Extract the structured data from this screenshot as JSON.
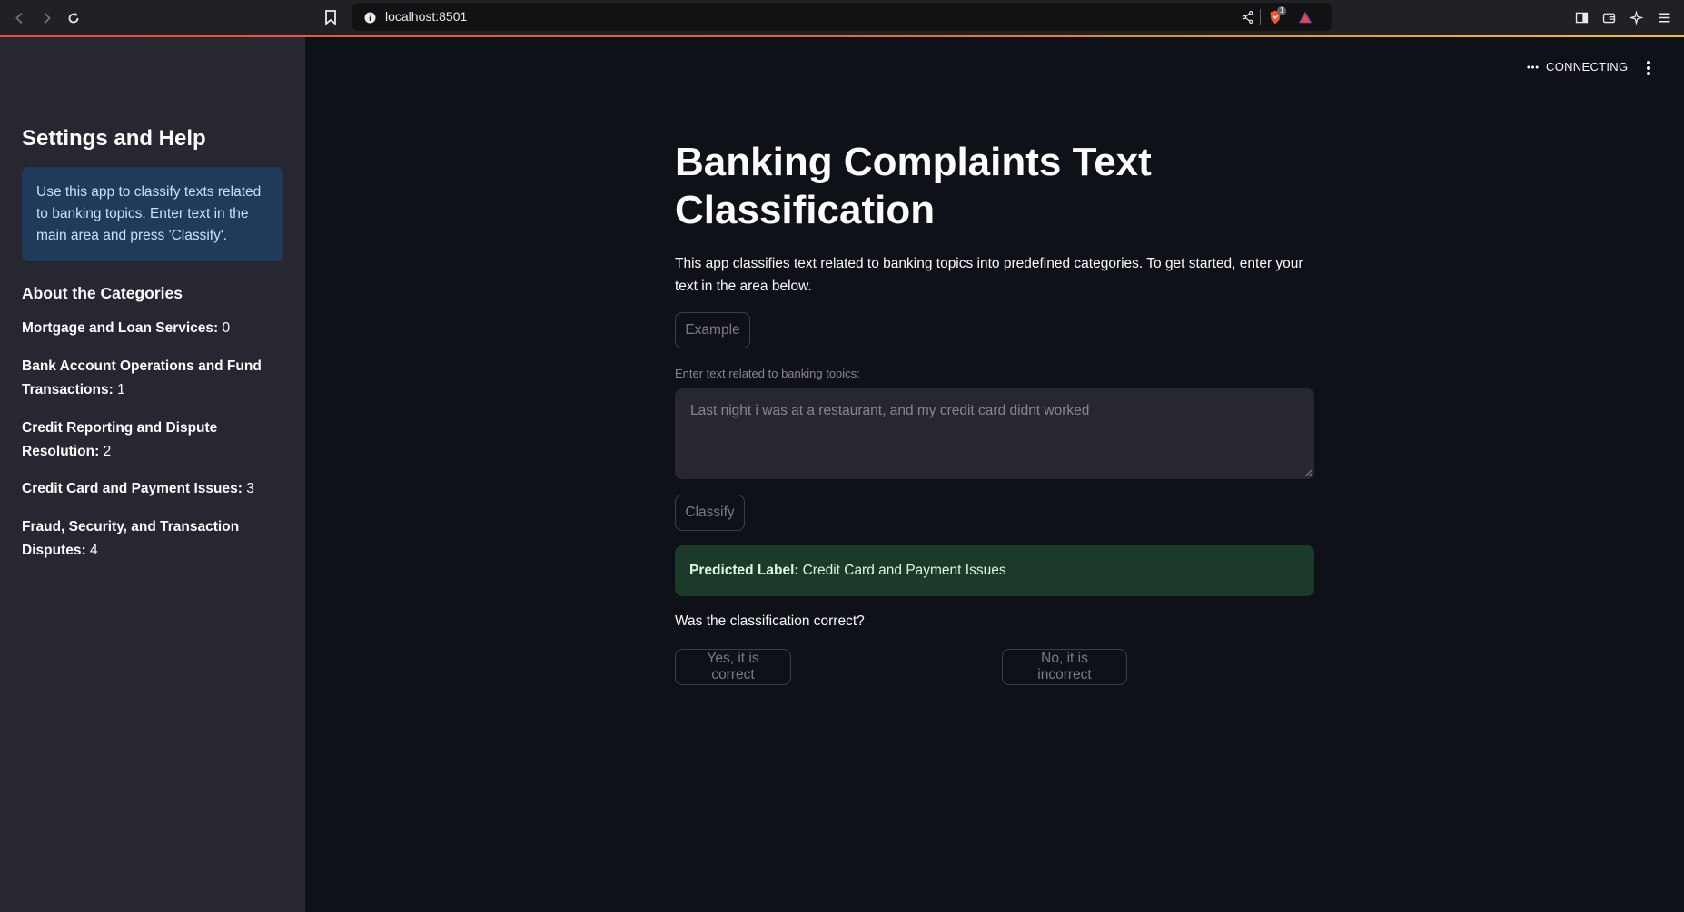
{
  "browser": {
    "url": "localhost:8501",
    "brave_badge": "1"
  },
  "sidebar": {
    "title": "Settings and Help",
    "info": "Use this app to classify texts related to banking topics. Enter text in the main area and press 'Classify'.",
    "categories_heading": "About the Categories",
    "categories": [
      {
        "name": "Mortgage and Loan Services:",
        "value": "0"
      },
      {
        "name": "Bank Account Operations and Fund Transactions:",
        "value": "1"
      },
      {
        "name": "Credit Reporting and Dispute Resolution:",
        "value": "2"
      },
      {
        "name": "Credit Card and Payment Issues:",
        "value": "3"
      },
      {
        "name": "Fraud, Security, and Transaction Disputes:",
        "value": "4"
      }
    ]
  },
  "header": {
    "status": "CONNECTING"
  },
  "main": {
    "title": "Banking Complaints Text Classification",
    "description": "This app classifies text related to banking topics into predefined categories. To get started, enter your text in the area below.",
    "example_button": "Example",
    "input_label": "Enter text related to banking topics:",
    "input_value": "Last night i was at a restaurant, and my credit card didnt worked",
    "classify_button": "Classify",
    "prediction_label": "Predicted Label:",
    "prediction_value": "Credit Card and Payment Issues",
    "question": "Was the classification correct?",
    "yes_button": "Yes, it is correct",
    "no_button": "No, it is incorrect"
  },
  "colors": {
    "app_bg": "#0e1117",
    "sidebar_bg": "#262730",
    "info_bg": "#1f3a5a",
    "success_bg": "#1b3a2a",
    "accent_line": "#e94e3c"
  }
}
